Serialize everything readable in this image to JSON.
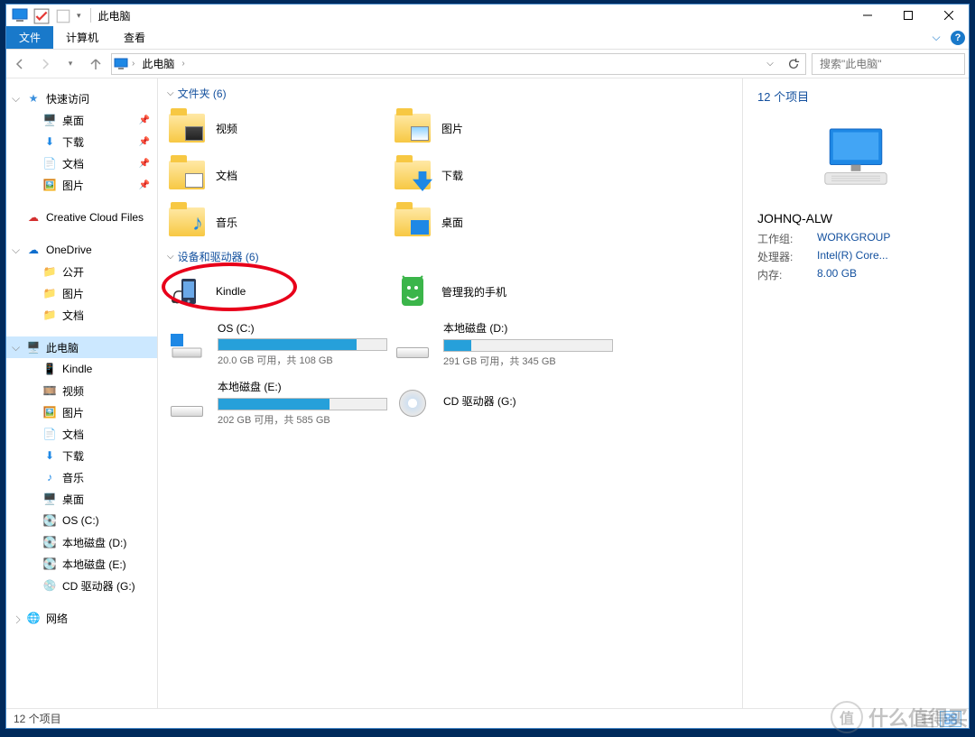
{
  "titlebar": {
    "title": "此电脑"
  },
  "ribbon": {
    "file": "文件",
    "computer": "计算机",
    "view": "查看"
  },
  "address": {
    "location": "此电脑",
    "sep": "›",
    "search_placeholder": "搜索\"此电脑\""
  },
  "sidebar": {
    "quick_access": "快速访问",
    "quick": [
      {
        "label": "桌面"
      },
      {
        "label": "下载"
      },
      {
        "label": "文档"
      },
      {
        "label": "图片"
      }
    ],
    "creative_cloud": "Creative Cloud Files",
    "onedrive": "OneDrive",
    "onedrive_items": [
      {
        "label": "公开"
      },
      {
        "label": "图片"
      },
      {
        "label": "文档"
      }
    ],
    "this_pc": "此电脑",
    "pc_items": [
      {
        "label": "Kindle"
      },
      {
        "label": "视频"
      },
      {
        "label": "图片"
      },
      {
        "label": "文档"
      },
      {
        "label": "下载"
      },
      {
        "label": "音乐"
      },
      {
        "label": "桌面"
      },
      {
        "label": "OS (C:)"
      },
      {
        "label": "本地磁盘 (D:)"
      },
      {
        "label": "本地磁盘 (E:)"
      },
      {
        "label": "CD 驱动器 (G:)"
      }
    ],
    "network": "网络"
  },
  "content": {
    "folders_header": "文件夹 (6)",
    "folders": [
      {
        "label": "视频"
      },
      {
        "label": "图片"
      },
      {
        "label": "文档"
      },
      {
        "label": "下载"
      },
      {
        "label": "音乐"
      },
      {
        "label": "桌面"
      }
    ],
    "devices_header": "设备和驱动器 (6)",
    "kindle": "Kindle",
    "manage_phone": "管理我的手机",
    "drives": {
      "c": {
        "name": "OS (C:)",
        "caption": "20.0 GB 可用，共 108 GB",
        "fill_pct": 82
      },
      "d": {
        "name": "本地磁盘 (D:)",
        "caption": "291 GB 可用，共 345 GB",
        "fill_pct": 16
      },
      "e": {
        "name": "本地磁盘 (E:)",
        "caption": "202 GB 可用，共 585 GB",
        "fill_pct": 66
      },
      "g": {
        "name": "CD 驱动器 (G:)"
      }
    }
  },
  "details": {
    "heading": "12 个项目",
    "computer_name": "JOHNQ-ALW",
    "rows": {
      "workgroup_k": "工作组:",
      "workgroup_v": "WORKGROUP",
      "cpu_k": "处理器:",
      "cpu_v": "Intel(R) Core...",
      "mem_k": "内存:",
      "mem_v": "8.00 GB"
    }
  },
  "status": {
    "text": "12 个项目"
  },
  "watermark": "什么值得买"
}
